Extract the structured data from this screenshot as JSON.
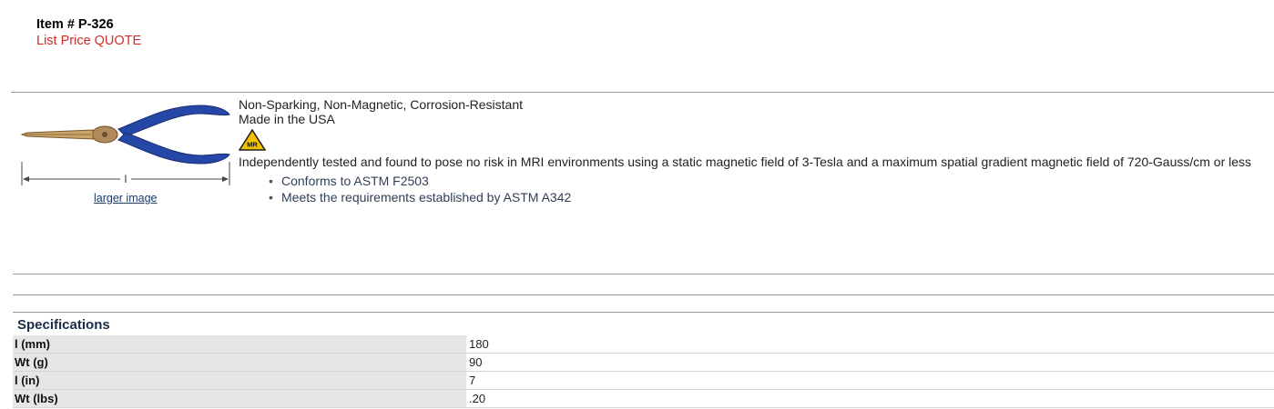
{
  "header": {
    "item_number": "Item # P-326",
    "list_price": "List Price QUOTE"
  },
  "image": {
    "larger_link": "larger image",
    "dimension_label": "l"
  },
  "description": {
    "line1": "Non-Sparking, Non-Magnetic, Corrosion-Resistant",
    "line2": "Made in the USA",
    "mr_badge": "MR",
    "mri_text": "Independently tested and found to pose no risk in MRI environments using a static magnetic field of 3-Tesla and a maximum spatial gradient magnetic field of 720-Gauss/cm or less",
    "bullets": [
      "Conforms to ASTM F2503",
      "Meets the requirements established by ASTM A342"
    ]
  },
  "specs": {
    "title": "Specifications",
    "rows": [
      {
        "label": "l (mm)",
        "value": "180"
      },
      {
        "label": "Wt (g)",
        "value": "90"
      },
      {
        "label": "l (in)",
        "value": "7"
      },
      {
        "label": "Wt (lbs)",
        "value": ".20"
      }
    ]
  },
  "colors": {
    "price": "#d32b2b",
    "handle": "#2447a8",
    "badge": "#f2c200"
  }
}
